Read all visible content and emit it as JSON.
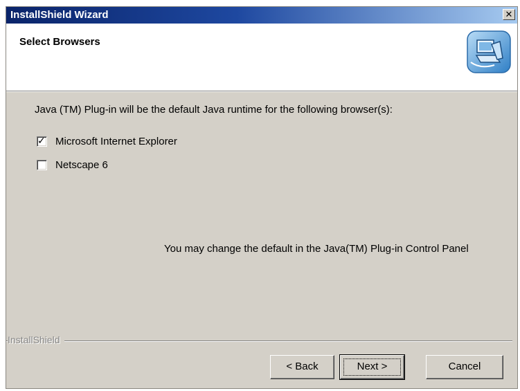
{
  "window": {
    "title": "InstallShield Wizard",
    "close_glyph": "✕"
  },
  "header": {
    "title": "Select Browsers",
    "icon": "installer-computer-icon"
  },
  "main": {
    "description": "Java (TM) Plug-in will be the default Java runtime for the following browser(s):",
    "browsers": [
      {
        "label": "Microsoft Internet Explorer",
        "checked": true
      },
      {
        "label": "Netscape 6",
        "checked": false
      }
    ],
    "info": "You may change the default in the Java(TM) Plug-in Control Panel"
  },
  "footer": {
    "brand": "InstallShield",
    "back_label": "< Back",
    "next_label": "Next >",
    "cancel_label": "Cancel"
  },
  "colors": {
    "dialog_face": "#d4d0c8",
    "title_start": "#0a246a",
    "title_end": "#a6caf0"
  }
}
